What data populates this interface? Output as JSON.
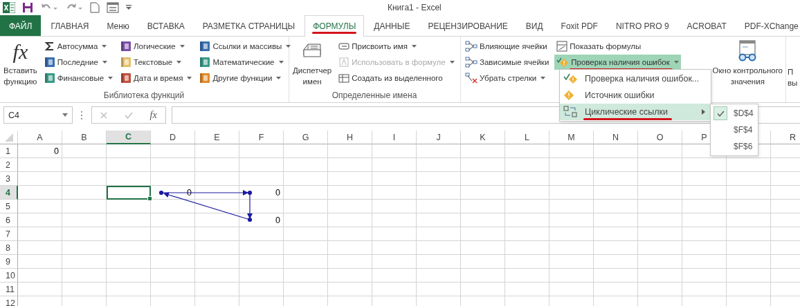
{
  "window": {
    "title": "Книга1 - Excel"
  },
  "tabs": [
    {
      "label": "ФАЙЛ",
      "kind": "file",
      "selected": false,
      "underlined": false
    },
    {
      "label": "ГЛАВНАЯ",
      "kind": "tab",
      "selected": false,
      "underlined": false
    },
    {
      "label": "Меню",
      "kind": "tab",
      "selected": false,
      "underlined": false
    },
    {
      "label": "ВСТАВКА",
      "kind": "tab",
      "selected": false,
      "underlined": false
    },
    {
      "label": "РАЗМЕТКА СТРАНИЦЫ",
      "kind": "tab",
      "selected": false,
      "underlined": false
    },
    {
      "label": "ФОРМУЛЫ",
      "kind": "tab",
      "selected": true,
      "underlined": true
    },
    {
      "label": "ДАННЫЕ",
      "kind": "tab",
      "selected": false,
      "underlined": false
    },
    {
      "label": "РЕЦЕНЗИРОВАНИЕ",
      "kind": "tab",
      "selected": false,
      "underlined": false
    },
    {
      "label": "ВИД",
      "kind": "tab",
      "selected": false,
      "underlined": false
    },
    {
      "label": "Foxit PDF",
      "kind": "tab",
      "selected": false,
      "underlined": false
    },
    {
      "label": "NITRO PRO 9",
      "kind": "tab",
      "selected": false,
      "underlined": false
    },
    {
      "label": "ACROBAT",
      "kind": "tab",
      "selected": false,
      "underlined": false
    },
    {
      "label": "PDF-XChange",
      "kind": "tab",
      "selected": false,
      "underlined": false
    }
  ],
  "ribbon": {
    "groups": [
      {
        "label": "Библиотека функций",
        "columns": [
          [
            {
              "kind": "large",
              "lines": [
                "Вставить",
                "функцию"
              ],
              "icon_text": "fx"
            }
          ],
          [
            {
              "kind": "small",
              "label": "Автосумма",
              "dropdown": true,
              "disabled": false,
              "highlighted": false,
              "underlined": false
            },
            {
              "kind": "small",
              "label": "Последние",
              "dropdown": true,
              "disabled": false,
              "highlighted": false,
              "underlined": false
            },
            {
              "kind": "small",
              "label": "Финансовые",
              "dropdown": true,
              "disabled": false,
              "highlighted": false,
              "underlined": false
            }
          ],
          [
            {
              "kind": "small",
              "label": "Логические",
              "dropdown": true,
              "disabled": false,
              "highlighted": false,
              "underlined": false
            },
            {
              "kind": "small",
              "label": "Текстовые",
              "dropdown": true,
              "disabled": false,
              "highlighted": false,
              "underlined": false
            },
            {
              "kind": "small",
              "label": "Дата и время",
              "dropdown": true,
              "disabled": false,
              "highlighted": false,
              "underlined": false
            }
          ],
          [
            {
              "kind": "small",
              "label": "Ссылки и массивы",
              "dropdown": true,
              "disabled": false,
              "highlighted": false,
              "underlined": false
            },
            {
              "kind": "small",
              "label": "Математические",
              "dropdown": true,
              "disabled": false,
              "highlighted": false,
              "underlined": false
            },
            {
              "kind": "small",
              "label": "Другие функции",
              "dropdown": true,
              "disabled": false,
              "highlighted": false,
              "underlined": false
            }
          ]
        ]
      },
      {
        "label": "Определенные имена",
        "columns": [
          [
            {
              "kind": "large",
              "lines": [
                "Диспетчер",
                "имен"
              ]
            }
          ],
          [
            {
              "kind": "small",
              "label": "Присвоить имя",
              "dropdown": true,
              "disabled": false,
              "highlighted": false,
              "underlined": false
            },
            {
              "kind": "small",
              "label": "Использовать в формуле",
              "dropdown": true,
              "disabled": true,
              "highlighted": false,
              "underlined": false
            },
            {
              "kind": "small",
              "label": "Создать из выделенного",
              "dropdown": false,
              "disabled": false,
              "highlighted": false,
              "underlined": false
            }
          ]
        ]
      },
      {
        "columns": [
          [
            {
              "kind": "small",
              "label": "Влияющие ячейки",
              "dropdown": false,
              "disabled": false,
              "highlighted": false,
              "underlined": false
            },
            {
              "kind": "small",
              "label": "Зависимые ячейки",
              "dropdown": false,
              "disabled": false,
              "highlighted": false,
              "underlined": false
            },
            {
              "kind": "small",
              "label": "Убрать стрелки",
              "dropdown": true,
              "disabled": false,
              "highlighted": false,
              "underlined": false
            }
          ],
          [
            {
              "kind": "small",
              "label": "Показать формулы",
              "dropdown": false,
              "disabled": false,
              "highlighted": false,
              "underlined": false
            },
            {
              "kind": "small",
              "label": "Проверка наличия ошибок",
              "dropdown": true,
              "disabled": false,
              "highlighted": true,
              "underlined": true
            }
          ],
          [
            {
              "kind": "large",
              "lines": [
                "Окно контрольного",
                "значения"
              ]
            }
          ]
        ]
      },
      {
        "columns": [
          [
            {
              "kind": "large",
              "lines": [
                "П",
                "вы"
              ]
            }
          ]
        ]
      }
    ]
  },
  "formula_bar": {
    "name_box": "C4",
    "function_label": "fx"
  },
  "error_menu": {
    "items": [
      {
        "label": "Проверка наличия ошибок...",
        "highlighted": false,
        "submenu": false,
        "underlined": false
      },
      {
        "label": "Источник ошибки",
        "highlighted": false,
        "submenu": false,
        "underlined": false
      },
      {
        "label": "Циклические ссылки",
        "highlighted": true,
        "submenu": true,
        "underlined": true
      }
    ]
  },
  "circular_refs": {
    "items": [
      {
        "label": "$D$4",
        "checked": true
      },
      {
        "label": "$F$4",
        "checked": false
      },
      {
        "label": "$F$6",
        "checked": false
      }
    ]
  },
  "sheet": {
    "columns": [
      {
        "label": "A",
        "selected": false
      },
      {
        "label": "B",
        "selected": false
      },
      {
        "label": "C",
        "selected": true
      },
      {
        "label": "D",
        "selected": false
      },
      {
        "label": "E",
        "selected": false
      },
      {
        "label": "F",
        "selected": false
      },
      {
        "label": "G",
        "selected": false
      },
      {
        "label": "H",
        "selected": false
      },
      {
        "label": "I",
        "selected": false
      },
      {
        "label": "J",
        "selected": false
      },
      {
        "label": "K",
        "selected": false
      },
      {
        "label": "L",
        "selected": false
      },
      {
        "label": "M",
        "selected": false
      },
      {
        "label": "N",
        "selected": false
      },
      {
        "label": "O",
        "selected": false
      },
      {
        "label": "P",
        "selected": false
      },
      {
        "selected": false
      },
      {
        "label": "R",
        "selected": false
      }
    ],
    "rows": [
      {
        "label": "1",
        "selected": false,
        "cells": [
          "0"
        ]
      },
      {
        "label": "2",
        "selected": false
      },
      {
        "label": "3",
        "selected": false
      },
      {
        "label": "4",
        "selected": true,
        "cells": [
          null,
          null,
          null,
          "0",
          null,
          "0"
        ]
      },
      {
        "label": "5",
        "selected": false
      },
      {
        "label": "6",
        "selected": false,
        "cells": [
          null,
          null,
          null,
          null,
          null,
          "0"
        ]
      },
      {
        "label": "7",
        "selected": false
      },
      {
        "label": "8",
        "selected": false
      },
      {
        "label": "9",
        "selected": false
      },
      {
        "label": "10",
        "selected": false
      },
      {
        "label": "11",
        "selected": false
      },
      {
        "label": "12",
        "selected": false
      }
    ]
  }
}
